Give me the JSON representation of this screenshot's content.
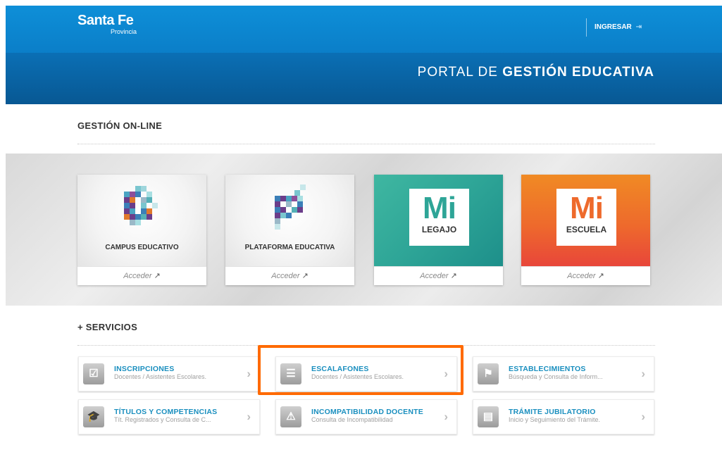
{
  "header": {
    "logo_line1": "Santa Fe",
    "logo_line2": "Provincia",
    "login_label": "INGRESAR",
    "login_icon": "sign-in-icon",
    "portal_title_light": "PORTAL DE",
    "portal_title_bold": "GESTIÓN EDUCATIVA"
  },
  "online": {
    "title": "GESTIÓN ON-LINE",
    "cards": [
      {
        "name": "CAMPUS EDUCATIVO",
        "action": "Acceder"
      },
      {
        "name": "PLATAFORMA EDUCATIVA",
        "action": "Acceder"
      },
      {
        "mi": "Mi",
        "name": "LEGAJO",
        "action": "Acceder",
        "color": "#2ea597"
      },
      {
        "mi": "Mi",
        "name": "ESCUELA",
        "action": "Acceder",
        "color": "#ee6a2c"
      }
    ]
  },
  "services": {
    "title": "+ SERVICIOS",
    "items": [
      {
        "title": "INSCRIPCIONES",
        "desc": "Docentes / Asistentes Escolares.",
        "icon": "check-icon"
      },
      {
        "title": "ESCALAFONES",
        "desc": "Docentes / Asistentes Escolares.",
        "icon": "list-icon"
      },
      {
        "title": "ESTABLECIMIENTOS",
        "desc": "Búsqueda y Consulta de Inform...",
        "icon": "flag-icon"
      },
      {
        "title": "TÍTULOS Y COMPETENCIAS",
        "desc": "Tít. Registrados y Consulta de C...",
        "icon": "graduation-cap-icon"
      },
      {
        "title": "INCOMPATIBILIDAD DOCENTE",
        "desc": "Consulta de Incompatibilidad",
        "icon": "warning-icon"
      },
      {
        "title": "TRÁMITE JUBILATORIO",
        "desc": "Inicio y Seguimiento del Trámite.",
        "icon": "archive-icon"
      }
    ]
  },
  "colors": {
    "accent": "#1a8fbf",
    "highlight": "#ff6a00",
    "header_blue": "#0a7cc6"
  }
}
